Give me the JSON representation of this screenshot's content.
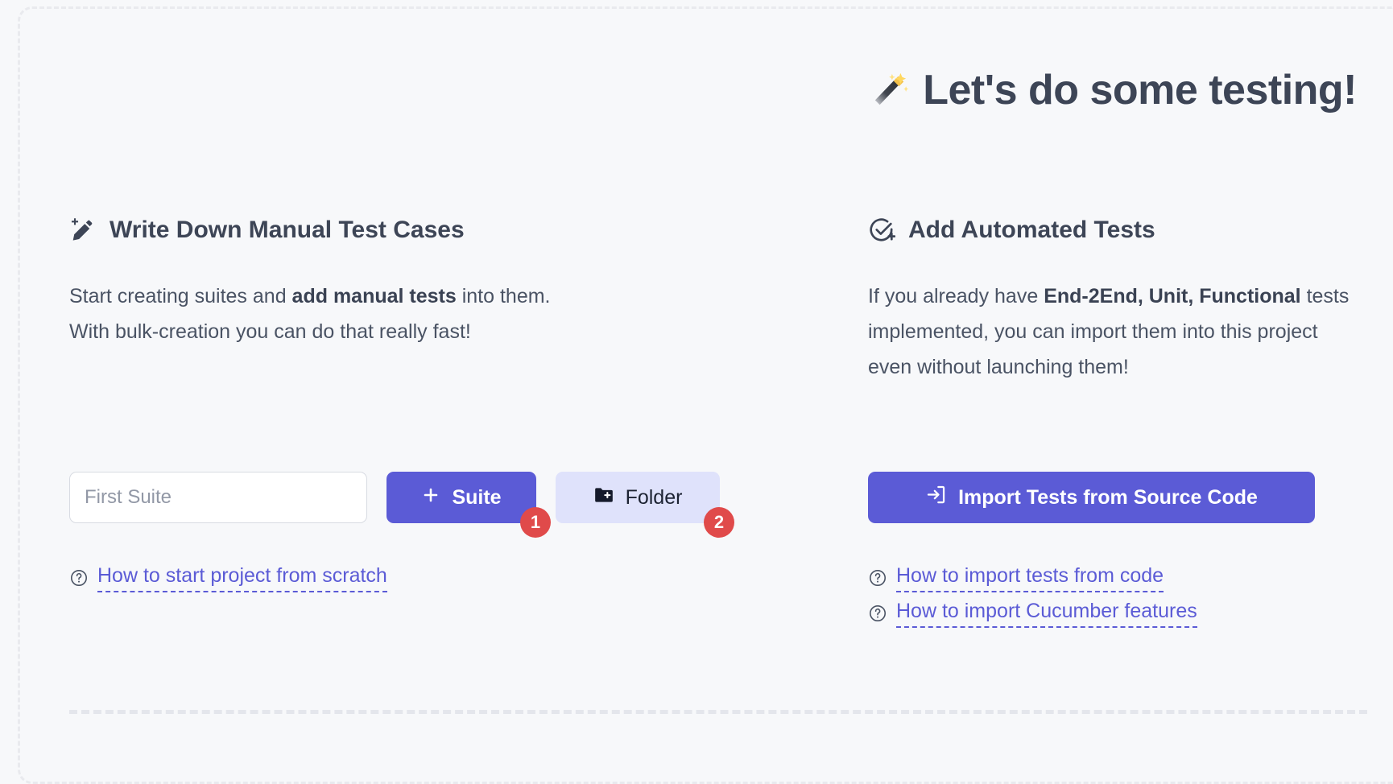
{
  "hero": {
    "emoji": "🪄",
    "title": "Let's do some testing!"
  },
  "manual": {
    "heading": "Write Down Manual Test Cases",
    "heading_icon": "magic-pencil-icon",
    "body_line1_pre": "Start creating suites and ",
    "body_line1_bold": "add manual tests",
    "body_line1_post": " into them.",
    "body_line2": "With bulk-creation you can do that really fast!",
    "input_placeholder": "First Suite",
    "input_value": "",
    "suite_button": "Suite",
    "suite_button_icon": "plus-icon",
    "suite_badge": "1",
    "folder_button": "Folder",
    "folder_button_icon": "folder-plus-icon",
    "folder_badge": "2",
    "link": "How to start project from scratch",
    "link_icon": "question-circle-icon"
  },
  "automated": {
    "heading": "Add Automated Tests",
    "heading_icon": "check-circle-plus-icon",
    "body_pre": "If you already have ",
    "body_bold1": "End-2End, Unit, Functional",
    "body_post": " tests implemented, you can import them into this project even without launching them!",
    "import_button": "Import Tests from Source Code",
    "import_button_icon": "import-arrow-icon",
    "links": [
      {
        "label": "How to import tests from code",
        "icon": "question-circle-icon"
      },
      {
        "label": "How to import Cucumber features",
        "icon": "question-circle-icon"
      }
    ]
  },
  "colors": {
    "background": "#f7f8fa",
    "accent": "#5b5bd6",
    "accent_soft": "#dfe2fb",
    "badge": "#e04a4a",
    "heading_text": "#3d4556",
    "body_text": "#4a5364",
    "dashed_border": "#e9eaee"
  }
}
